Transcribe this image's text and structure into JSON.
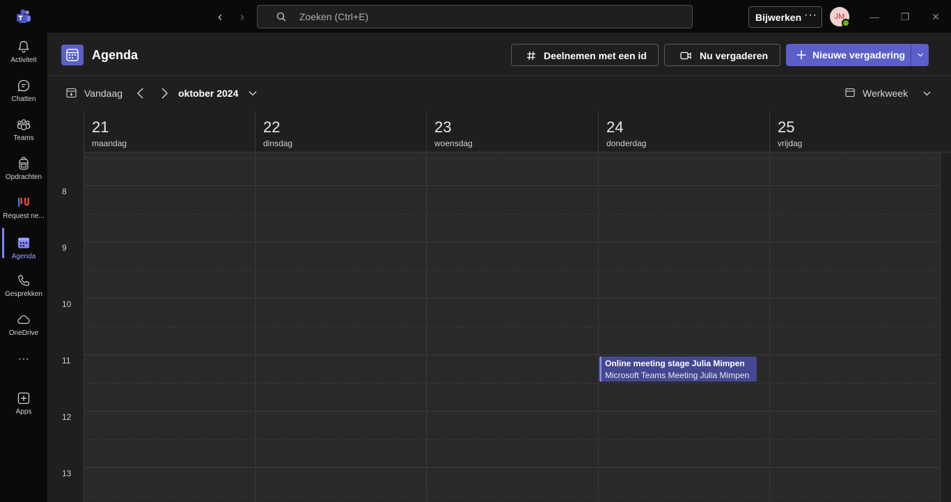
{
  "titlebar": {
    "search_placeholder": "Zoeken (Ctrl+E)",
    "update_label": "Bijwerken",
    "more_label": "···",
    "avatar_initials": "JM"
  },
  "rail": {
    "items": [
      {
        "label": "Activiteit",
        "icon": "bell-icon"
      },
      {
        "label": "Chatten",
        "icon": "chat-icon"
      },
      {
        "label": "Teams",
        "icon": "teams-icon"
      },
      {
        "label": "Opdrachten",
        "icon": "backpack-icon"
      },
      {
        "label": "Request ne...",
        "icon": "request-app-icon"
      },
      {
        "label": "Agenda",
        "icon": "calendar-icon",
        "active": true
      },
      {
        "label": "Gesprekken",
        "icon": "phone-icon"
      },
      {
        "label": "OneDrive",
        "icon": "cloud-icon"
      },
      {
        "label": "···",
        "icon": "more-icon"
      },
      {
        "label": "Apps",
        "icon": "apps-icon"
      }
    ]
  },
  "header": {
    "title": "Agenda",
    "join_label": "Deelnemen met een id",
    "meet_now_label": "Nu vergaderen",
    "new_meeting_label": "Nieuwe vergadering"
  },
  "toolbar": {
    "today_label": "Vandaag",
    "month_label": "oktober 2024",
    "view_label": "Werkweek"
  },
  "days": [
    {
      "num": "21",
      "name": "maandag"
    },
    {
      "num": "22",
      "name": "dinsdag"
    },
    {
      "num": "23",
      "name": "woensdag"
    },
    {
      "num": "24",
      "name": "donderdag"
    },
    {
      "num": "25",
      "name": "vrijdag"
    }
  ],
  "hours": [
    "8",
    "9",
    "10",
    "11",
    "12",
    "13"
  ],
  "event": {
    "title": "Online meeting stage Julia Mimpen",
    "subtitle": "Microsoft Teams Meeting  Julia Mimpen"
  },
  "colors": {
    "accent": "#5b5fc7",
    "event_bg": "#444791",
    "event_bar": "#7f85f5",
    "presence": "#6bb700"
  }
}
